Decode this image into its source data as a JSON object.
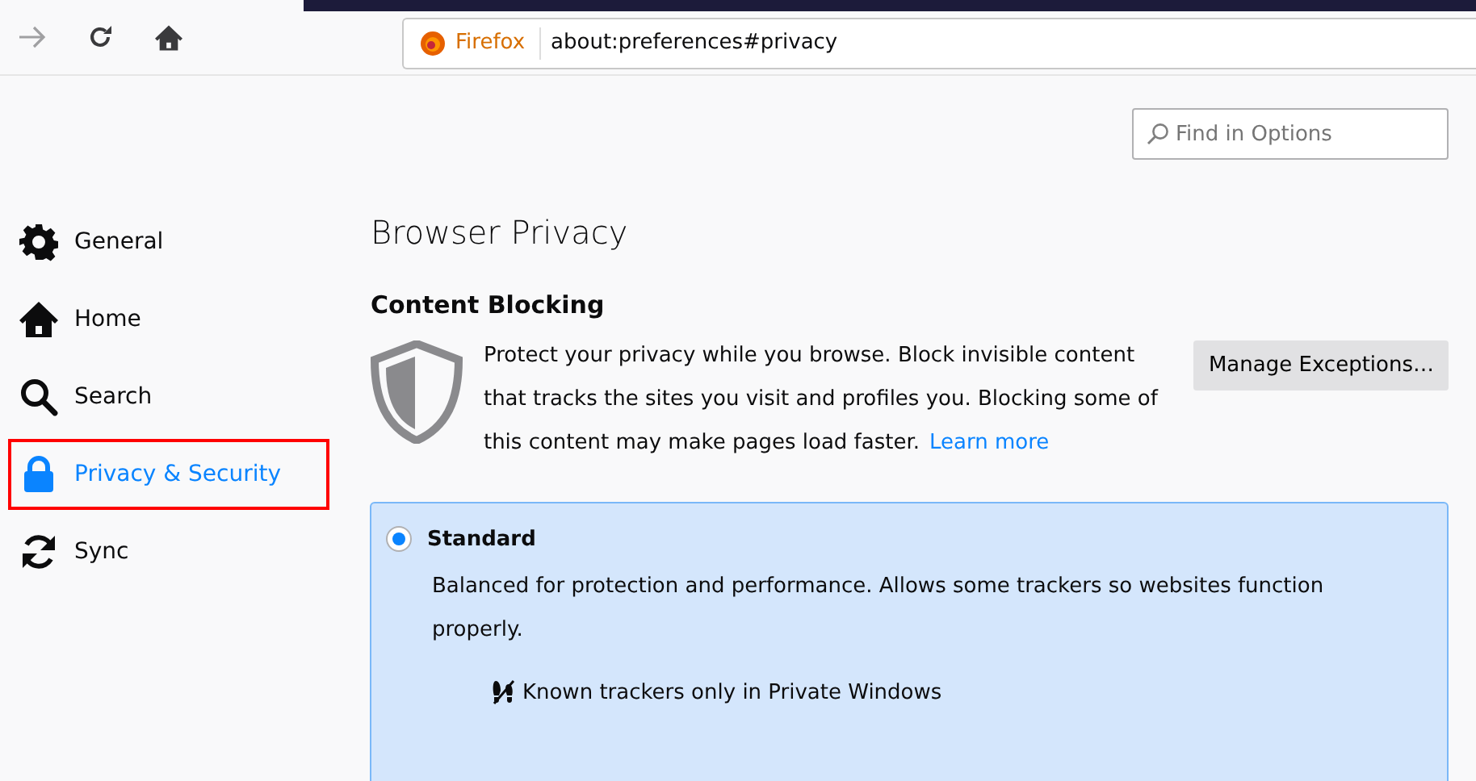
{
  "toolbar": {
    "identity_label": "Firefox",
    "url": "about:preferences#privacy"
  },
  "search": {
    "placeholder": "Find in Options"
  },
  "sidebar": {
    "items": [
      {
        "label": "General",
        "kind": "gear",
        "selected": false
      },
      {
        "label": "Home",
        "kind": "home",
        "selected": false
      },
      {
        "label": "Search",
        "kind": "search",
        "selected": false
      },
      {
        "label": "Privacy & Security",
        "kind": "lock",
        "selected": true
      },
      {
        "label": "Sync",
        "kind": "sync",
        "selected": false
      }
    ]
  },
  "page_title": "Browser Privacy",
  "content_blocking": {
    "heading": "Content Blocking",
    "description": "Protect your privacy while you browse. Block invisible content that tracks the sites you visit and profiles you. Blocking some of this content may make pages load faster.",
    "link": "Learn more",
    "button": "Manage Exceptions…",
    "options": [
      {
        "label": "Standard",
        "selected": true,
        "description": "Balanced for protection and performance. Allows some trackers so websites function properly.",
        "features": [
          "Known trackers only in Private Windows"
        ]
      }
    ]
  }
}
